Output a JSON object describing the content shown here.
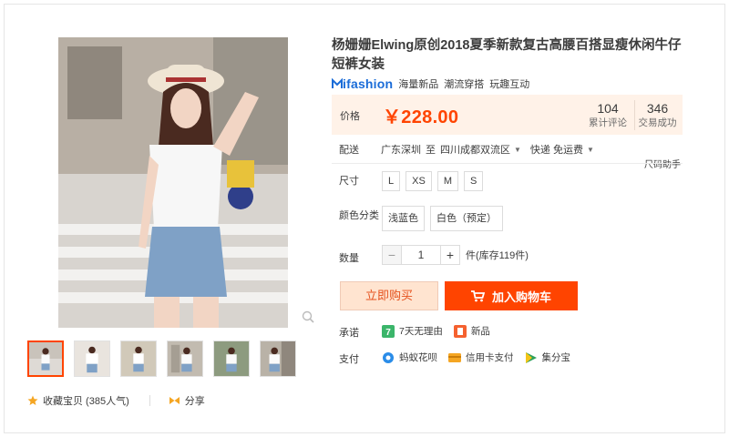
{
  "product": {
    "title": "杨姗姗Elwing原创2018夏季新款复古高腰百搭显瘦休闲牛仔短裤女装"
  },
  "brand": {
    "logo_text": "ifashion",
    "tags": [
      "海量新品",
      "潮流穿搭",
      "玩趣互动"
    ]
  },
  "price": {
    "label": "价格",
    "value": "￥228.00",
    "reviews_num": "104",
    "reviews_label": "累计评论",
    "sales_num": "346",
    "sales_label": "交易成功"
  },
  "shipping": {
    "label": "配送",
    "from": "广东深圳",
    "to_word": "至",
    "to": "四川成都双流区",
    "express": "快递 免运费",
    "size_helper": "尺码助手"
  },
  "size": {
    "label": "尺寸",
    "options": [
      "L",
      "XS",
      "M",
      "S"
    ]
  },
  "color": {
    "label": "颜色分类",
    "options": [
      "浅蓝色",
      "白色（预定）"
    ]
  },
  "quantity": {
    "label": "数量",
    "minus": "−",
    "value": "1",
    "plus": "+",
    "stock": "件(库存119件)"
  },
  "actions": {
    "buy_now": "立即购买",
    "add_to_cart": "加入购物车"
  },
  "promise": {
    "label": "承诺",
    "items": [
      "7天无理由",
      "新品"
    ]
  },
  "payment": {
    "label": "支付",
    "items": [
      "蚂蚁花呗",
      "信用卡支付",
      "集分宝"
    ]
  },
  "footer": {
    "favorite": "收藏宝贝 (385人气)",
    "share": "分享"
  },
  "colors": {
    "accent": "#ff4400",
    "price_bg": "#fff2e8",
    "brand_blue": "#1a6cd8"
  }
}
